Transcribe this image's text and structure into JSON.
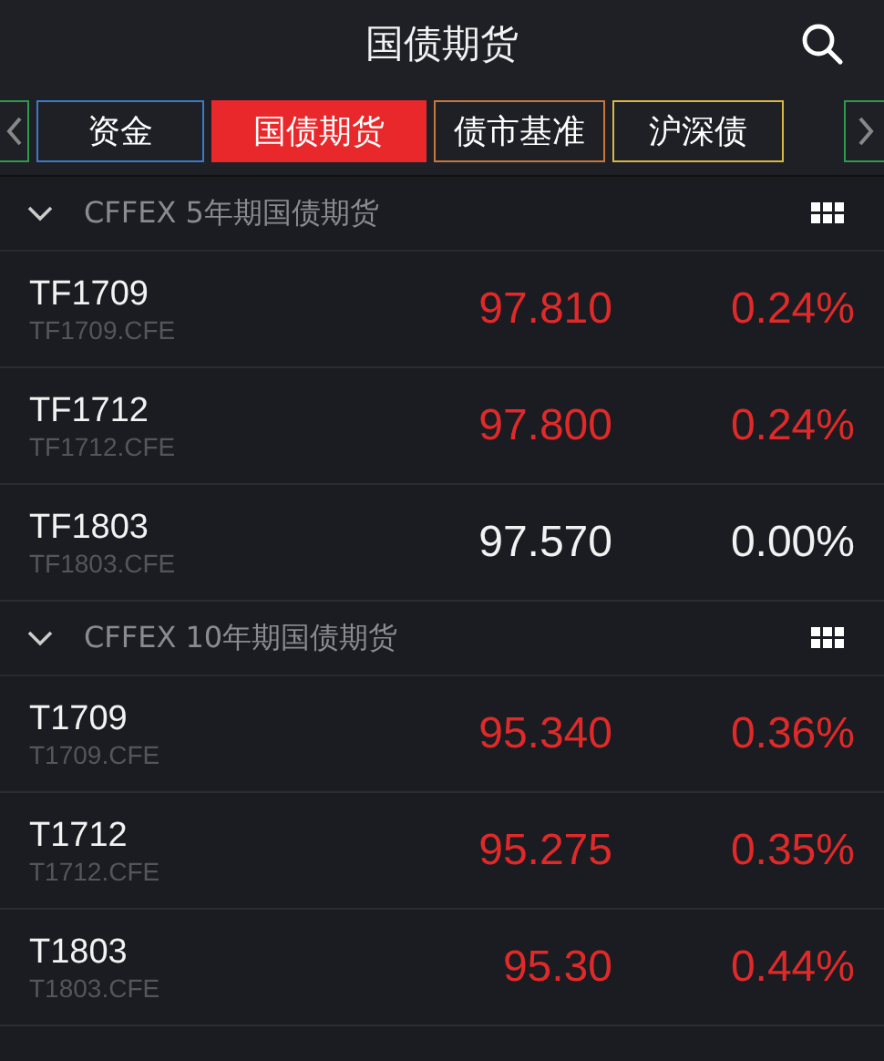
{
  "header": {
    "title": "国债期货"
  },
  "tabs": [
    {
      "label": "资金",
      "selected": false,
      "color": "#3a7bc8"
    },
    {
      "label": "国债期货",
      "selected": true,
      "color": "#e8282b"
    },
    {
      "label": "债市基准",
      "selected": false,
      "color": "#c8783a"
    },
    {
      "label": "沪深债",
      "selected": false,
      "color": "#d8b840"
    }
  ],
  "sections": [
    {
      "title": "CFFEX 5年期国债期货",
      "expanded": true,
      "rows": [
        {
          "name": "TF1709",
          "code": "TF1709.CFE",
          "price": "97.810",
          "change": "0.24%",
          "kind": "up"
        },
        {
          "name": "TF1712",
          "code": "TF1712.CFE",
          "price": "97.800",
          "change": "0.24%",
          "kind": "up"
        },
        {
          "name": "TF1803",
          "code": "TF1803.CFE",
          "price": "97.570",
          "change": "0.00%",
          "kind": "flat"
        }
      ]
    },
    {
      "title": "CFFEX 10年期国债期货",
      "expanded": true,
      "rows": [
        {
          "name": "T1709",
          "code": "T1709.CFE",
          "price": "95.340",
          "change": "0.36%",
          "kind": "up"
        },
        {
          "name": "T1712",
          "code": "T1712.CFE",
          "price": "95.275",
          "change": "0.35%",
          "kind": "up"
        },
        {
          "name": "T1803",
          "code": "T1803.CFE",
          "price": "95.30",
          "change": "0.44%",
          "kind": "up"
        }
      ]
    }
  ]
}
